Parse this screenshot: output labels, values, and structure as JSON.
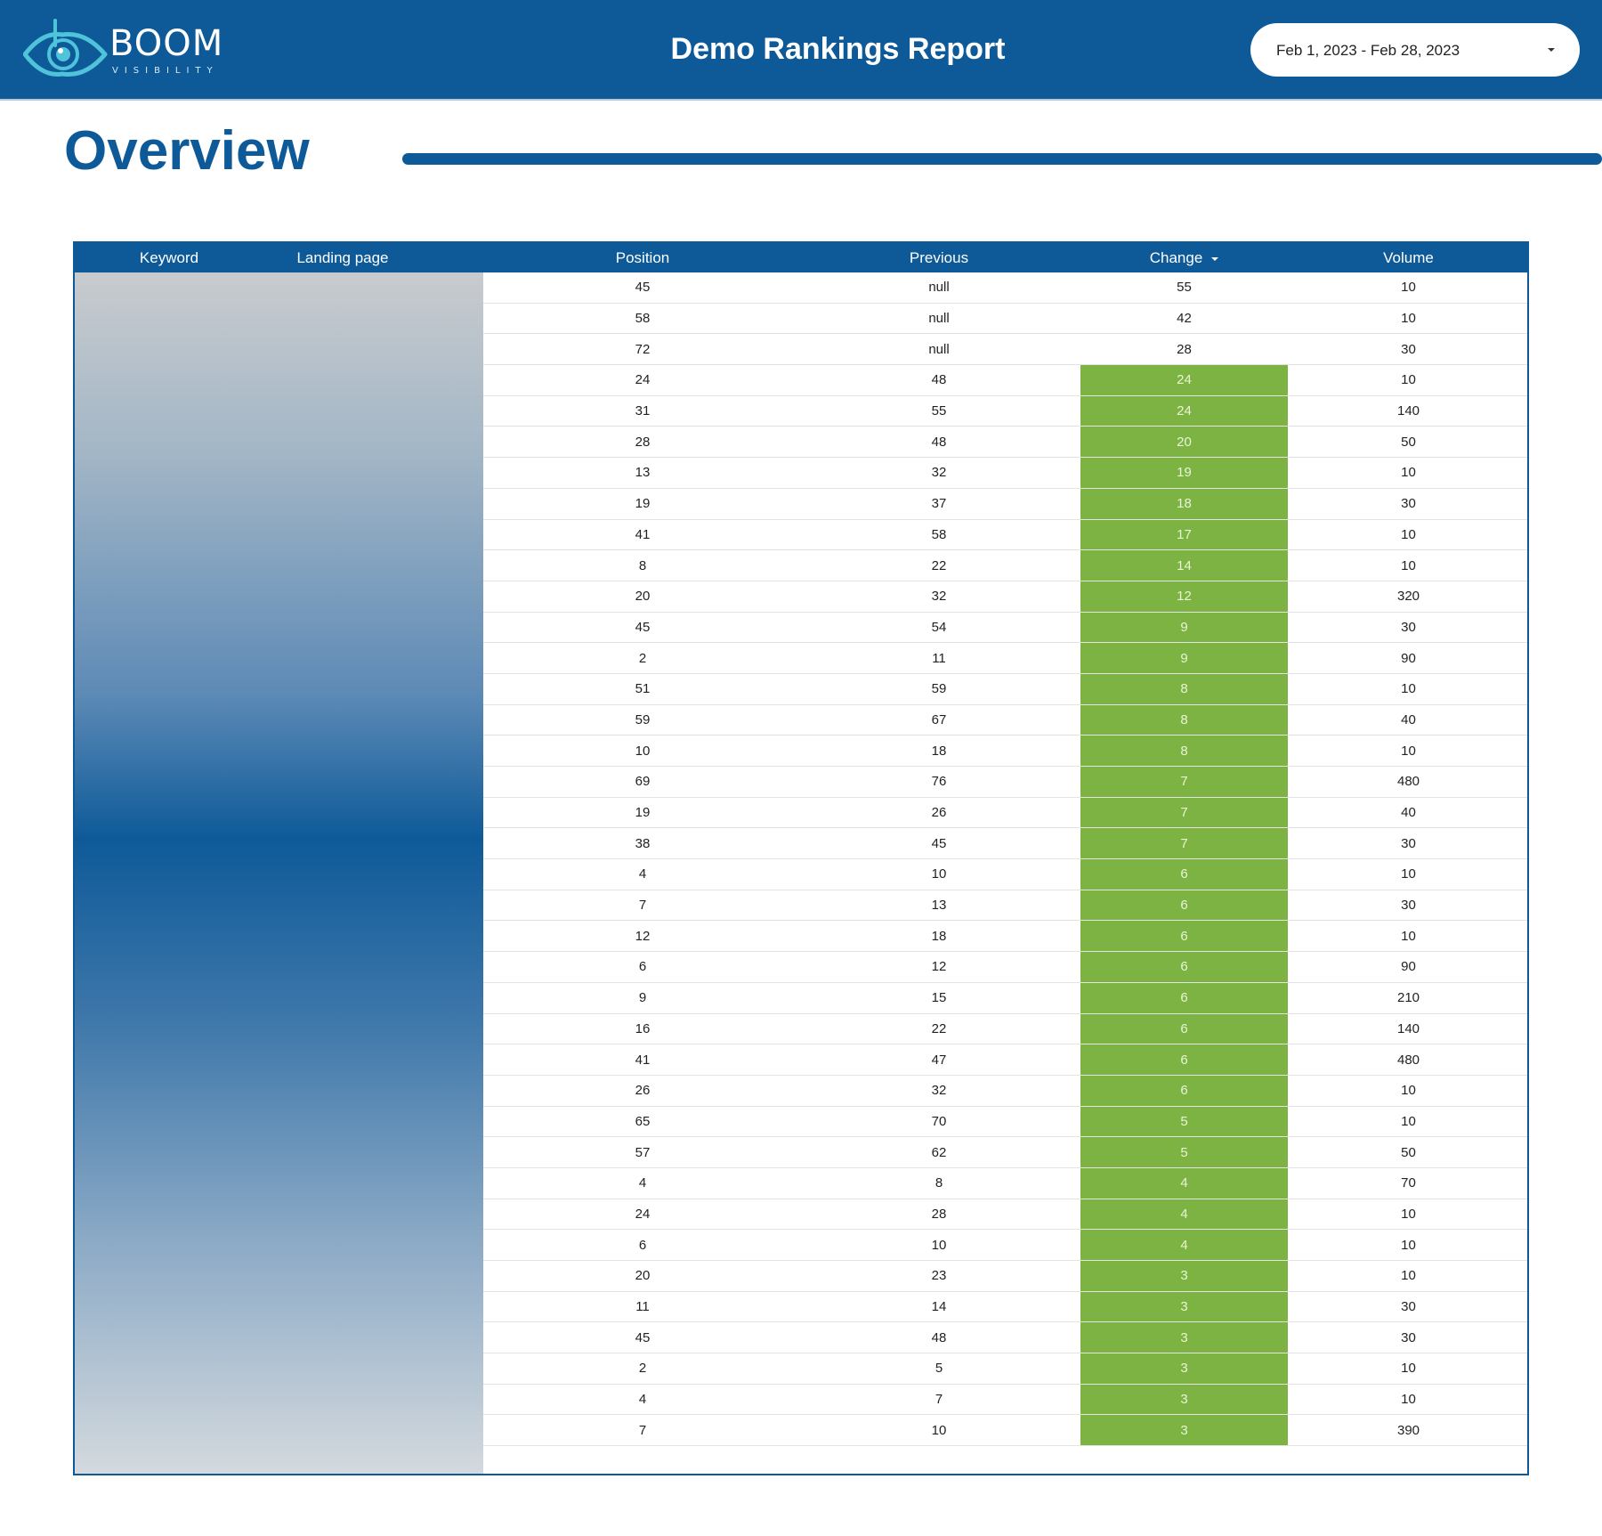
{
  "header": {
    "brand_name": "BOOM",
    "brand_tagline": "VISIBILITY",
    "title": "Demo Rankings Report",
    "date_range": "Feb 1, 2023 - Feb 28, 2023"
  },
  "section": {
    "title": "Overview"
  },
  "table": {
    "columns": {
      "keyword": "Keyword",
      "landing_page": "Landing page",
      "position": "Position",
      "previous": "Previous",
      "change": "Change",
      "volume": "Volume"
    },
    "sorted_by": "Change (descending)",
    "rows": [
      {
        "position": "45",
        "previous": "null",
        "change": "55",
        "volume": "10",
        "improved": false
      },
      {
        "position": "58",
        "previous": "null",
        "change": "42",
        "volume": "10",
        "improved": false
      },
      {
        "position": "72",
        "previous": "null",
        "change": "28",
        "volume": "30",
        "improved": false
      },
      {
        "position": "24",
        "previous": "48",
        "change": "24",
        "volume": "10",
        "improved": true
      },
      {
        "position": "31",
        "previous": "55",
        "change": "24",
        "volume": "140",
        "improved": true
      },
      {
        "position": "28",
        "previous": "48",
        "change": "20",
        "volume": "50",
        "improved": true
      },
      {
        "position": "13",
        "previous": "32",
        "change": "19",
        "volume": "10",
        "improved": true
      },
      {
        "position": "19",
        "previous": "37",
        "change": "18",
        "volume": "30",
        "improved": true
      },
      {
        "position": "41",
        "previous": "58",
        "change": "17",
        "volume": "10",
        "improved": true
      },
      {
        "position": "8",
        "previous": "22",
        "change": "14",
        "volume": "10",
        "improved": true
      },
      {
        "position": "20",
        "previous": "32",
        "change": "12",
        "volume": "320",
        "improved": true
      },
      {
        "position": "45",
        "previous": "54",
        "change": "9",
        "volume": "30",
        "improved": true
      },
      {
        "position": "2",
        "previous": "11",
        "change": "9",
        "volume": "90",
        "improved": true
      },
      {
        "position": "51",
        "previous": "59",
        "change": "8",
        "volume": "10",
        "improved": true
      },
      {
        "position": "59",
        "previous": "67",
        "change": "8",
        "volume": "40",
        "improved": true
      },
      {
        "position": "10",
        "previous": "18",
        "change": "8",
        "volume": "10",
        "improved": true
      },
      {
        "position": "69",
        "previous": "76",
        "change": "7",
        "volume": "480",
        "improved": true
      },
      {
        "position": "19",
        "previous": "26",
        "change": "7",
        "volume": "40",
        "improved": true
      },
      {
        "position": "38",
        "previous": "45",
        "change": "7",
        "volume": "30",
        "improved": true
      },
      {
        "position": "4",
        "previous": "10",
        "change": "6",
        "volume": "10",
        "improved": true
      },
      {
        "position": "7",
        "previous": "13",
        "change": "6",
        "volume": "30",
        "improved": true
      },
      {
        "position": "12",
        "previous": "18",
        "change": "6",
        "volume": "10",
        "improved": true
      },
      {
        "position": "6",
        "previous": "12",
        "change": "6",
        "volume": "90",
        "improved": true
      },
      {
        "position": "9",
        "previous": "15",
        "change": "6",
        "volume": "210",
        "improved": true
      },
      {
        "position": "16",
        "previous": "22",
        "change": "6",
        "volume": "140",
        "improved": true
      },
      {
        "position": "41",
        "previous": "47",
        "change": "6",
        "volume": "480",
        "improved": true
      },
      {
        "position": "26",
        "previous": "32",
        "change": "6",
        "volume": "10",
        "improved": true
      },
      {
        "position": "65",
        "previous": "70",
        "change": "5",
        "volume": "10",
        "improved": true
      },
      {
        "position": "57",
        "previous": "62",
        "change": "5",
        "volume": "50",
        "improved": true
      },
      {
        "position": "4",
        "previous": "8",
        "change": "4",
        "volume": "70",
        "improved": true
      },
      {
        "position": "24",
        "previous": "28",
        "change": "4",
        "volume": "10",
        "improved": true
      },
      {
        "position": "6",
        "previous": "10",
        "change": "4",
        "volume": "10",
        "improved": true
      },
      {
        "position": "20",
        "previous": "23",
        "change": "3",
        "volume": "10",
        "improved": true
      },
      {
        "position": "11",
        "previous": "14",
        "change": "3",
        "volume": "30",
        "improved": true
      },
      {
        "position": "45",
        "previous": "48",
        "change": "3",
        "volume": "30",
        "improved": true
      },
      {
        "position": "2",
        "previous": "5",
        "change": "3",
        "volume": "10",
        "improved": true
      },
      {
        "position": "4",
        "previous": "7",
        "change": "3",
        "volume": "10",
        "improved": true
      },
      {
        "position": "7",
        "previous": "10",
        "change": "3",
        "volume": "390",
        "improved": true
      }
    ]
  },
  "colors": {
    "brand_blue": "#0e5a99",
    "improved_green": "#7cb342",
    "logo_teal": "#4fc3d9"
  },
  "icons": [
    "eye-logo-icon",
    "chevron-down-icon",
    "sort-descending-icon"
  ]
}
